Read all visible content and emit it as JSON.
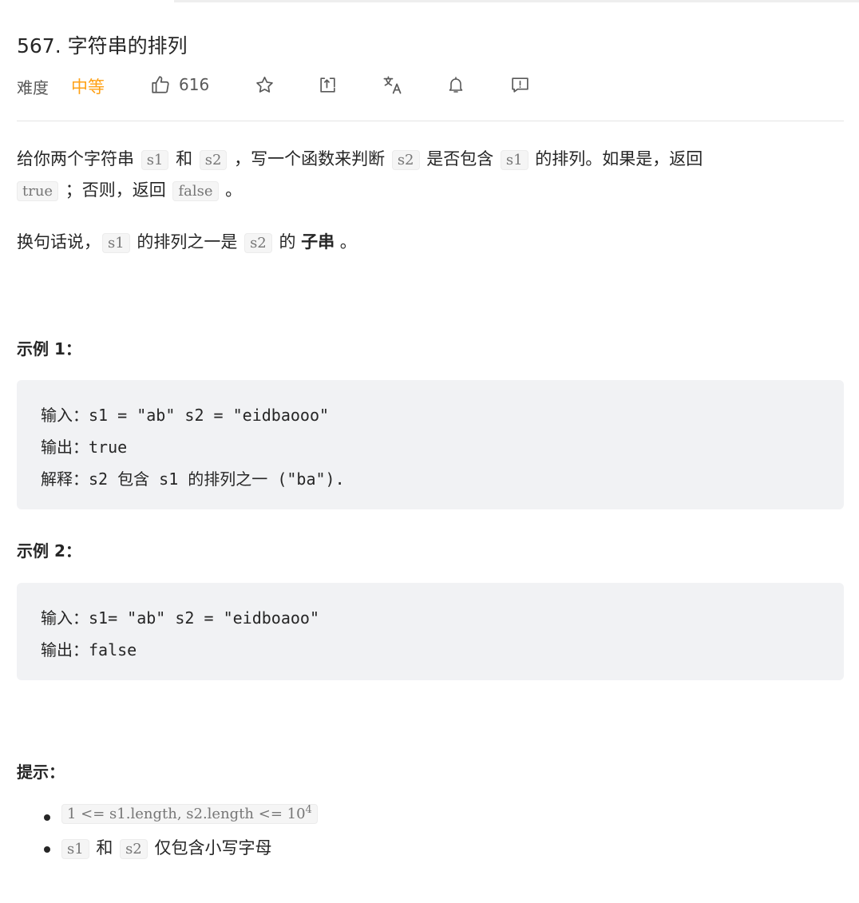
{
  "problem": {
    "title": "567. 字符串的排列",
    "difficulty_label": "难度",
    "difficulty": "中等",
    "likes": "616"
  },
  "description": {
    "p1": [
      "给你两个字符串 ",
      "s1",
      " 和 ",
      "s2",
      " ，写一个函数来判断 ",
      "s2",
      " 是否包含 ",
      "s1",
      " 的排列。如果是，返回"
    ],
    "p1_line2": [
      "true",
      " ；否则，返回 ",
      "false",
      " 。"
    ],
    "p2": [
      "换句话说，",
      "s1",
      " 的排列之一是 ",
      "s2",
      " 的 ",
      "子串",
      " 。"
    ]
  },
  "examples": [
    {
      "heading": "示例 1：",
      "lines": [
        "输入：s1 = \"ab\" s2 = \"eidbaooo\"",
        "输出：true",
        "解释：s2 包含 s1 的排列之一 (\"ba\")."
      ]
    },
    {
      "heading": "示例 2：",
      "lines": [
        "输入：s1= \"ab\" s2 = \"eidboaoo\"",
        "输出：false"
      ]
    }
  ],
  "hints": {
    "heading": "提示：",
    "item1": {
      "code": "1 <= s1.length, s2.length <= 10",
      "sup": "4"
    },
    "item2": [
      "s1",
      " 和 ",
      "s2",
      " 仅包含小写字母"
    ]
  },
  "icons": [
    "thumbs-up-icon",
    "star-icon",
    "share-icon",
    "translate-icon",
    "bell-icon",
    "feedback-icon"
  ],
  "colors": {
    "difficulty_medium": "#ffa116",
    "code_bg": "#f5f5f5",
    "example_bg": "#f1f2f4"
  }
}
